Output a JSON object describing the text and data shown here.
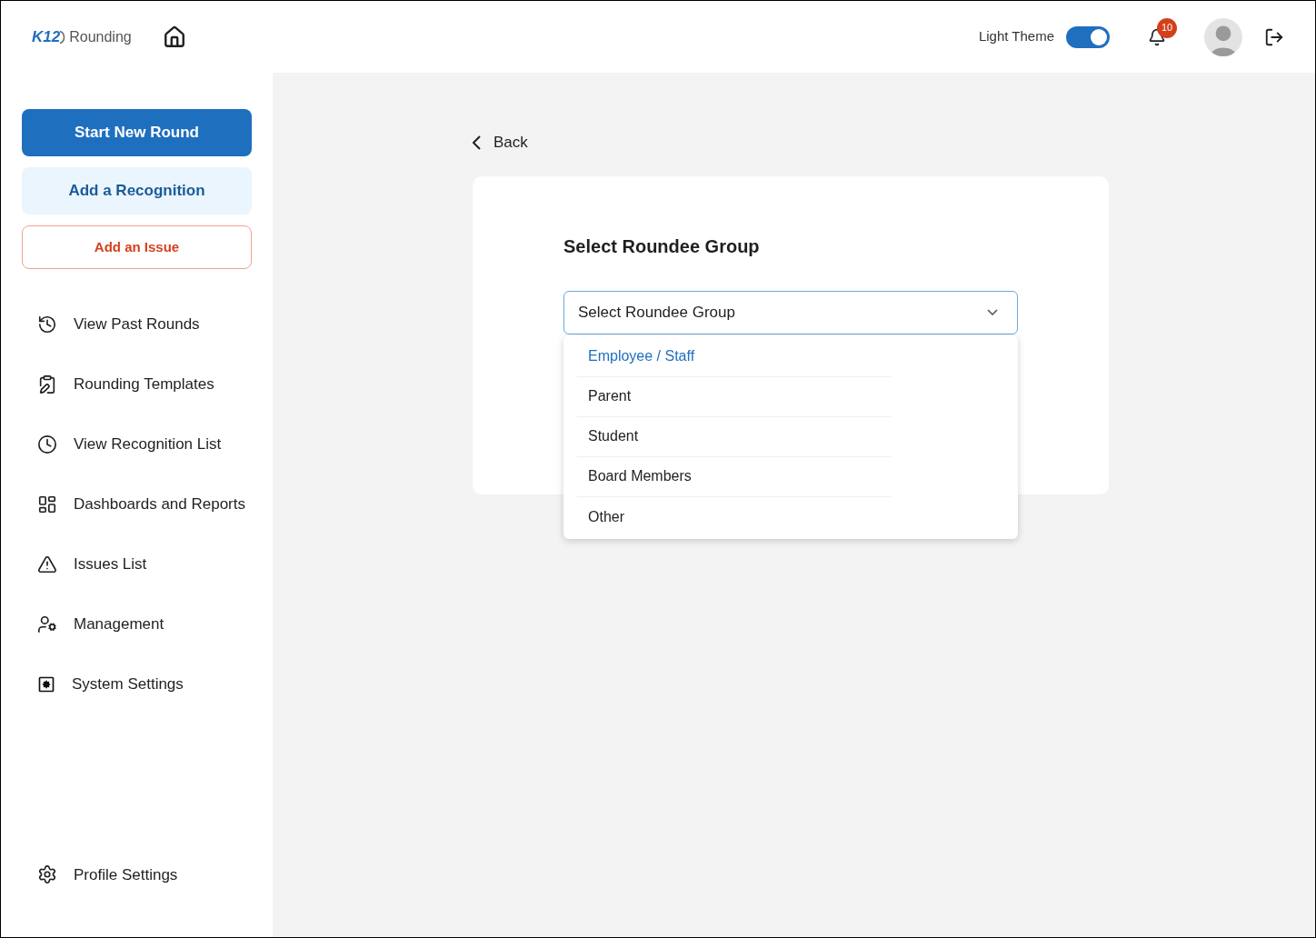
{
  "header": {
    "logo": {
      "mark": "K12",
      "name": "Rounding"
    },
    "theme_toggle": {
      "label": "Light Theme",
      "on": true
    },
    "notifications": {
      "count": "10"
    }
  },
  "sidebar": {
    "actions": [
      {
        "label": "Start New Round",
        "kind": "primary"
      },
      {
        "label": "Add a Recognition",
        "kind": "secondary"
      },
      {
        "label": "Add an Issue",
        "kind": "danger"
      }
    ],
    "items": [
      {
        "label": "View Past Rounds"
      },
      {
        "label": "Rounding Templates"
      },
      {
        "label": "View Recognition List"
      },
      {
        "label": "Dashboards and Reports"
      },
      {
        "label": "Issues List"
      },
      {
        "label": "Management"
      },
      {
        "label": "System Settings"
      }
    ],
    "footer_item": {
      "label": "Profile Settings"
    }
  },
  "main": {
    "back": "Back",
    "card": {
      "title": "Select Roundee Group",
      "select": {
        "placeholder": "Select Roundee Group",
        "expanded": true,
        "options": [
          {
            "label": "Employee / Staff",
            "selected": true
          },
          {
            "label": "Parent",
            "selected": false
          },
          {
            "label": "Student",
            "selected": false
          },
          {
            "label": "Board Members",
            "selected": false
          },
          {
            "label": "Other",
            "selected": false
          }
        ]
      }
    }
  }
}
